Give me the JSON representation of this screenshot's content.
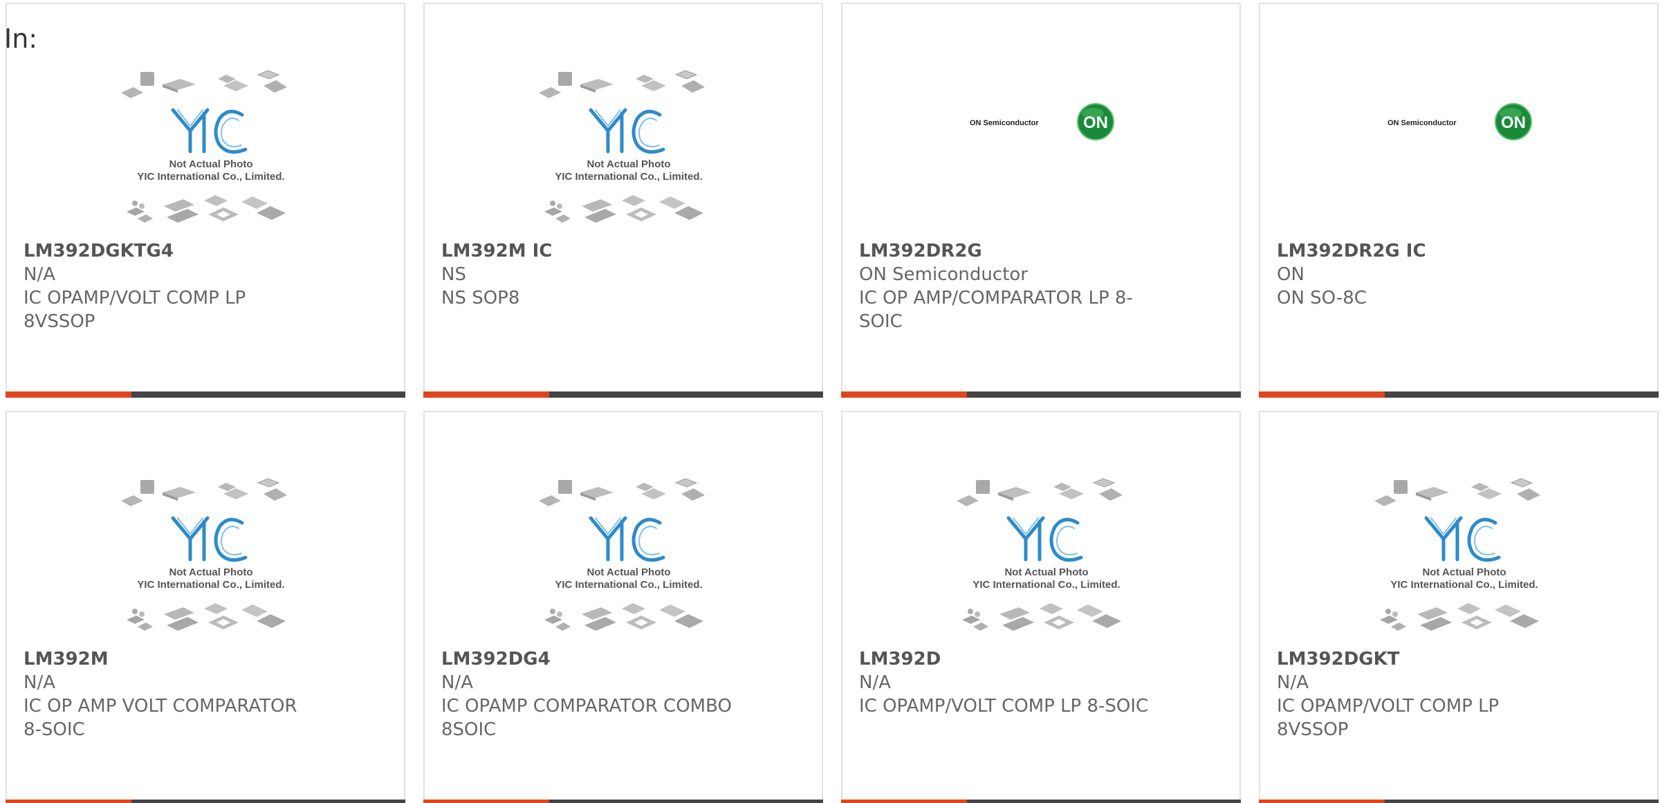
{
  "header": {
    "in_label": "In:"
  },
  "placeholder_image": {
    "line1": "Not Actual Photo",
    "line2": "YIC International Co., Limited.",
    "logo_text": "YIC"
  },
  "brand_image": {
    "company": "ON Semiconductor",
    "badge": "ON"
  },
  "colors": {
    "accent": "#e0451e",
    "bar": "#444444",
    "border": "#e2e2e2",
    "logo_blue": "#2e8bc9",
    "on_green": "#1a8a3a"
  },
  "products": [
    {
      "part": "LM392DGKTG4",
      "maker": "N/A",
      "desc1": "IC OPAMP/VOLT COMP LP",
      "desc2": "8VSSOP",
      "image": "placeholder"
    },
    {
      "part": "LM392M IC",
      "maker": "NS",
      "desc1": "NS SOP8",
      "desc2": "",
      "image": "placeholder"
    },
    {
      "part": "LM392DR2G",
      "maker": "ON Semiconductor",
      "desc1": "IC OP AMP/COMPARATOR LP 8-",
      "desc2": "SOIC",
      "image": "brand"
    },
    {
      "part": "LM392DR2G IC",
      "maker": "ON",
      "desc1": "ON SO-8C",
      "desc2": "",
      "image": "brand"
    },
    {
      "part": "LM392M",
      "maker": "N/A",
      "desc1": "IC OP AMP VOLT COMPARATOR",
      "desc2": "8-SOIC",
      "image": "placeholder"
    },
    {
      "part": "LM392DG4",
      "maker": "N/A",
      "desc1": "IC OPAMP COMPARATOR COMBO",
      "desc2": "8SOIC",
      "image": "placeholder"
    },
    {
      "part": "LM392D",
      "maker": "N/A",
      "desc1": "IC OPAMP/VOLT COMP LP 8-SOIC",
      "desc2": "",
      "image": "placeholder"
    },
    {
      "part": "LM392DGKT",
      "maker": "N/A",
      "desc1": "IC OPAMP/VOLT COMP LP",
      "desc2": "8VSSOP",
      "image": "placeholder"
    }
  ]
}
